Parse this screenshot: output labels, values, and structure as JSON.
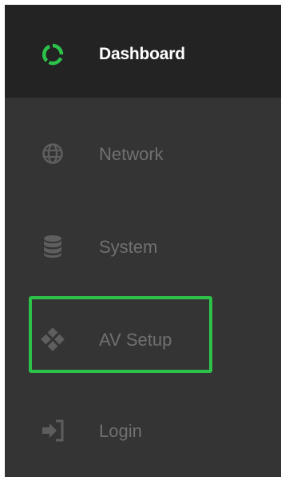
{
  "sidebar": {
    "items": [
      {
        "id": "dashboard",
        "label": "Dashboard",
        "icon": "dashboard-ring-icon",
        "active": true
      },
      {
        "id": "network",
        "label": "Network",
        "icon": "globe-icon",
        "active": false
      },
      {
        "id": "system",
        "label": "System",
        "icon": "database-icon",
        "active": false
      },
      {
        "id": "av-setup",
        "label": "AV Setup",
        "icon": "diamond-grid-icon",
        "active": false,
        "highlighted": true
      },
      {
        "id": "login",
        "label": "Login",
        "icon": "sign-in-icon",
        "active": false
      }
    ]
  },
  "colors": {
    "sidebar_bg": "#343434",
    "active_bg": "#232323",
    "active_text": "#ffffff",
    "inactive_text": "#707070",
    "accent_green": "#2cc24a"
  }
}
